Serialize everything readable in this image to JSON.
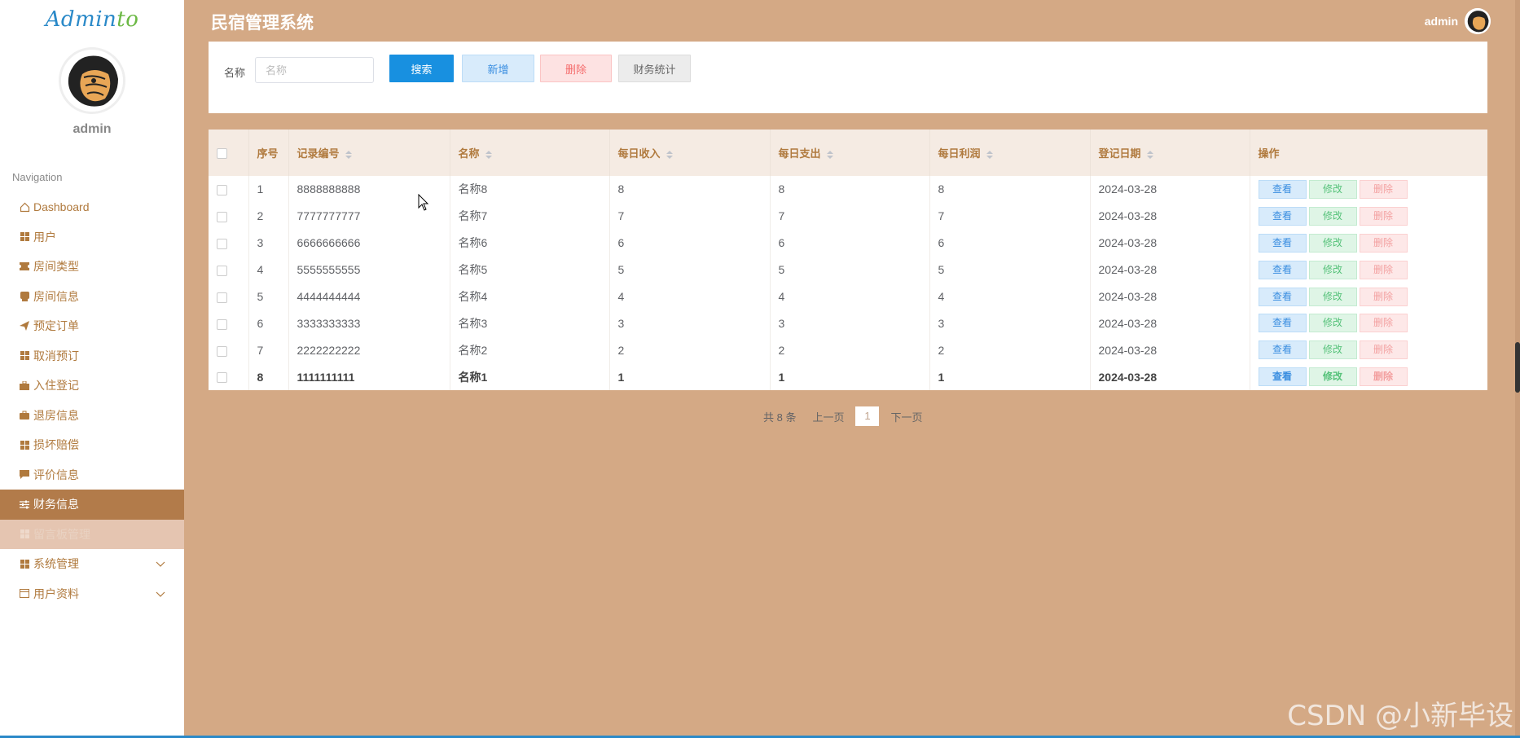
{
  "sidebar": {
    "logo_main": "Admin",
    "logo_accent": "to",
    "profile_name": "admin",
    "nav_title": "Navigation",
    "items": [
      {
        "label": "Dashboard",
        "icon": "home-icon"
      },
      {
        "label": "用户",
        "icon": "grid-icon"
      },
      {
        "label": "房间类型",
        "icon": "ticket-icon"
      },
      {
        "label": "房间信息",
        "icon": "bookmark-icon"
      },
      {
        "label": "预定订单",
        "icon": "send-icon"
      },
      {
        "label": "取消预订",
        "icon": "grid-icon"
      },
      {
        "label": "入住登记",
        "icon": "briefcase-icon"
      },
      {
        "label": "退房信息",
        "icon": "bag-icon"
      },
      {
        "label": "损坏赔偿",
        "icon": "grid-icon"
      },
      {
        "label": "评价信息",
        "icon": "comment-icon"
      },
      {
        "label": "财务信息",
        "icon": "sliders-icon"
      },
      {
        "label": "留言板管理",
        "icon": "grid-icon"
      },
      {
        "label": "系统管理",
        "icon": "grid-icon"
      },
      {
        "label": "用户资料",
        "icon": "window-icon"
      }
    ]
  },
  "header": {
    "title": "民宿管理系统",
    "user": "admin"
  },
  "search": {
    "label": "名称",
    "placeholder": "名称",
    "value": "",
    "search_btn": "搜索",
    "add_btn": "新增",
    "delete_btn": "删除",
    "stats_btn": "财务统计"
  },
  "table": {
    "columns": [
      "序号",
      "记录编号",
      "名称",
      "每日收入",
      "每日支出",
      "每日利润",
      "登记日期",
      "操作"
    ],
    "actions": {
      "view": "查看",
      "edit": "修改",
      "delete": "删除"
    },
    "rows": [
      {
        "index": "1",
        "code": "8888888888",
        "name": "名称8",
        "income": "8",
        "expense": "8",
        "profit": "8",
        "date": "2024-03-28"
      },
      {
        "index": "2",
        "code": "7777777777",
        "name": "名称7",
        "income": "7",
        "expense": "7",
        "profit": "7",
        "date": "2024-03-28"
      },
      {
        "index": "3",
        "code": "6666666666",
        "name": "名称6",
        "income": "6",
        "expense": "6",
        "profit": "6",
        "date": "2024-03-28"
      },
      {
        "index": "4",
        "code": "5555555555",
        "name": "名称5",
        "income": "5",
        "expense": "5",
        "profit": "5",
        "date": "2024-03-28"
      },
      {
        "index": "5",
        "code": "4444444444",
        "name": "名称4",
        "income": "4",
        "expense": "4",
        "profit": "4",
        "date": "2024-03-28"
      },
      {
        "index": "6",
        "code": "3333333333",
        "name": "名称3",
        "income": "3",
        "expense": "3",
        "profit": "3",
        "date": "2024-03-28"
      },
      {
        "index": "7",
        "code": "2222222222",
        "name": "名称2",
        "income": "2",
        "expense": "2",
        "profit": "2",
        "date": "2024-03-28"
      },
      {
        "index": "8",
        "code": "1111111111",
        "name": "名称1",
        "income": "1",
        "expense": "1",
        "profit": "1",
        "date": "2024-03-28"
      }
    ]
  },
  "pagination": {
    "total": "共 8 条",
    "prev": "上一页",
    "page": "1",
    "next": "下一页"
  },
  "watermark": "CSDN @小新毕设",
  "colors": {
    "background": "#d4a985",
    "accent": "#b07a3e",
    "active_nav": "#b27b4a",
    "primary": "#1890e0"
  }
}
